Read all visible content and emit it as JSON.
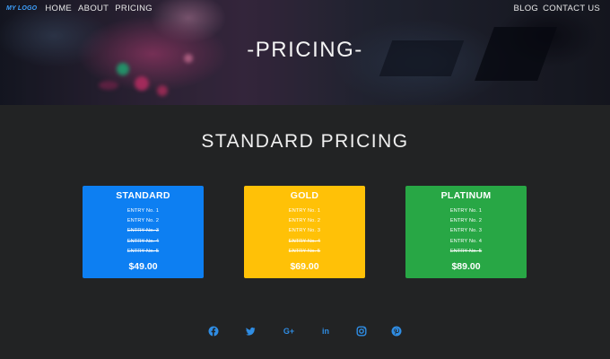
{
  "nav": {
    "logo": "MY LOGO",
    "left_links": [
      "HOME",
      "ABOUT",
      "PRICING"
    ],
    "right_links": [
      "BLOG",
      "CONTACT US"
    ]
  },
  "hero": {
    "title": "-PRICING-"
  },
  "section": {
    "title": "STANDARD PRICING"
  },
  "plans": [
    {
      "name": "STANDARD",
      "color": "#0d7ff2",
      "entries": [
        {
          "label": "ENTRY No. 1",
          "included": true
        },
        {
          "label": "ENTRY No. 2",
          "included": true
        },
        {
          "label": "ENTRY No. 3",
          "included": false
        },
        {
          "label": "ENTRY No. 4",
          "included": false
        },
        {
          "label": "ENTRY No. 5",
          "included": false
        }
      ],
      "price": "$49.00"
    },
    {
      "name": "GOLD",
      "color": "#ffc107",
      "entries": [
        {
          "label": "ENTRY No. 1",
          "included": true
        },
        {
          "label": "ENTRY No. 2",
          "included": true
        },
        {
          "label": "ENTRY No. 3",
          "included": true
        },
        {
          "label": "ENTRY No. 4",
          "included": false
        },
        {
          "label": "ENTRY No. 5",
          "included": false
        }
      ],
      "price": "$69.00"
    },
    {
      "name": "PLATINUM",
      "color": "#28a745",
      "entries": [
        {
          "label": "ENTRY No. 1",
          "included": true
        },
        {
          "label": "ENTRY No. 2",
          "included": true
        },
        {
          "label": "ENTRY No. 3",
          "included": true
        },
        {
          "label": "ENTRY No. 4",
          "included": true
        },
        {
          "label": "ENTRY No. 5",
          "included": false
        }
      ],
      "price": "$89.00"
    }
  ],
  "social": {
    "color": "#2f8de4",
    "icons": [
      "facebook-icon",
      "twitter-icon",
      "google-plus-icon",
      "linkedin-icon",
      "instagram-icon",
      "pinterest-icon"
    ],
    "google_plus_glyph": "G+",
    "linkedin_glyph": "in"
  }
}
